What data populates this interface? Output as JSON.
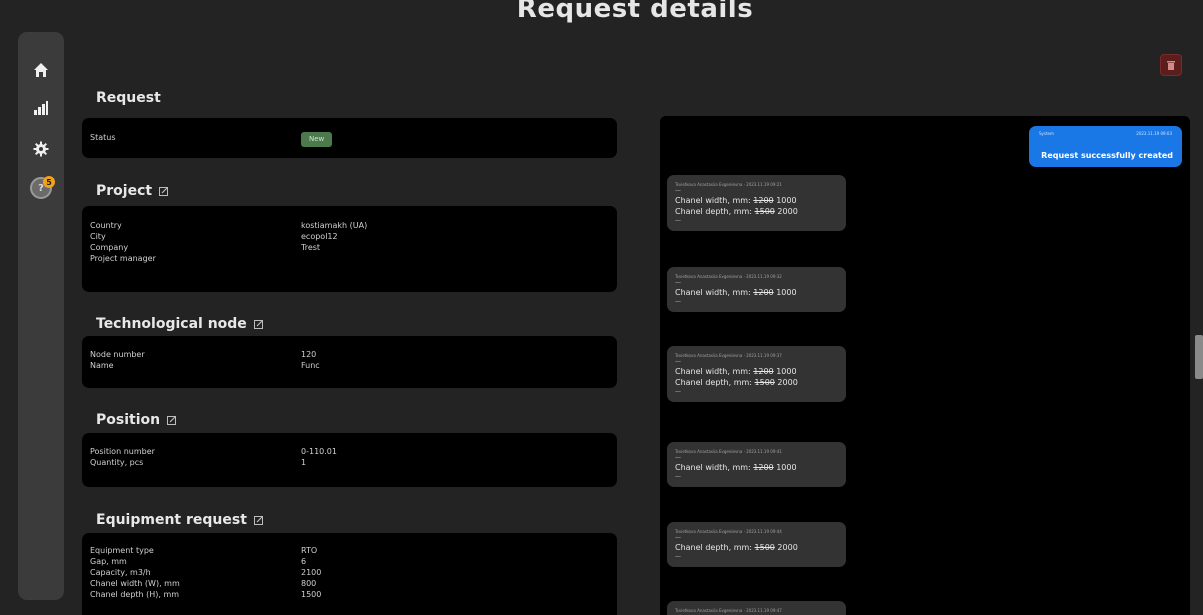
{
  "page": {
    "title": "Request details"
  },
  "sidebar": {
    "items": [
      {
        "icon": "home-icon"
      },
      {
        "icon": "bar-chart-icon"
      },
      {
        "icon": "gear-icon"
      },
      {
        "icon": "help-icon",
        "badge": "5"
      }
    ]
  },
  "request": {
    "heading": "Request",
    "rows": [
      {
        "key": "Status",
        "value": "New"
      }
    ]
  },
  "project": {
    "heading": "Project",
    "rows": [
      {
        "key": "Country",
        "value": "kostiamakh (UA)"
      },
      {
        "key": "City",
        "value": "ecopol12"
      },
      {
        "key": "Company",
        "value": "Trest"
      },
      {
        "key": "Project manager",
        "value": ""
      }
    ]
  },
  "node": {
    "heading": "Technological node",
    "rows": [
      {
        "key": "Node number",
        "value": "120"
      },
      {
        "key": "Name",
        "value": "Func"
      }
    ]
  },
  "position": {
    "heading": "Position",
    "rows": [
      {
        "key": "Position number",
        "value": "0-110.01"
      },
      {
        "key": "Quantity, pcs",
        "value": "1"
      }
    ]
  },
  "equipment": {
    "heading": "Equipment request",
    "rows": [
      {
        "key": "Equipment type",
        "value": "RTO"
      },
      {
        "key": "Gap, mm",
        "value": "6"
      },
      {
        "key": "Capacity, m3/h",
        "value": "2100"
      },
      {
        "key": "Chanel width (W), mm",
        "value": "800"
      },
      {
        "key": "Chanel depth (H), mm",
        "value": "1500"
      }
    ]
  },
  "chat": {
    "own_message": {
      "author": "System",
      "time": "2023.11.19 09:03",
      "text": "Request successfully created"
    },
    "messages": [
      {
        "meta": "Tsvietkova Anastasiia Evgenievna · 2023.11.19 09:21",
        "dash_top": "—",
        "lines": [
          {
            "label": "Chanel width, mm:",
            "old": "1200",
            "new": "1000"
          },
          {
            "label": "Chanel depth, mm:",
            "old": "1500",
            "new": "2000"
          }
        ],
        "dash_bottom": "—"
      },
      {
        "meta": "Tsvietkova Anastasiia Evgenievna · 2023.11.19 09:32",
        "dash_top": "—",
        "lines": [
          {
            "label": "Chanel width, mm:",
            "old": "1200",
            "new": "1000"
          }
        ],
        "dash_bottom": "—"
      },
      {
        "meta": "Tsvietkova Anastasiia Evgenievna · 2023.11.19 09:37",
        "dash_top": "—",
        "lines": [
          {
            "label": "Chanel width, mm:",
            "old": "1200",
            "new": "1000"
          },
          {
            "label": "Chanel depth, mm:",
            "old": "1500",
            "new": "2000"
          }
        ],
        "dash_bottom": "—"
      },
      {
        "meta": "Tsvietkova Anastasiia Evgenievna · 2023.11.19 09:41",
        "dash_top": "—",
        "lines": [
          {
            "label": "Chanel width, mm:",
            "old": "1200",
            "new": "1000"
          }
        ],
        "dash_bottom": "—"
      },
      {
        "meta": "Tsvietkova Anastasiia Evgenievna · 2023.11.19 09:44",
        "dash_top": "—",
        "lines": [
          {
            "label": "Chanel depth, mm:",
            "old": "1500",
            "new": "2000"
          }
        ],
        "dash_bottom": "—"
      },
      {
        "meta": "Tsvietkova Anastasiia Evgenievna · 2023.11.19 09:47",
        "dash_top": "",
        "lines": [],
        "dash_bottom": ""
      }
    ]
  },
  "colors": {
    "background": "#232323",
    "card": "#000000",
    "sidebar": "#3b3b3b",
    "accent_blue": "#1a78e6",
    "status_green": "#4c7a4c",
    "badge_orange": "#f3a21b",
    "delete_red": "#5c1d1d"
  }
}
